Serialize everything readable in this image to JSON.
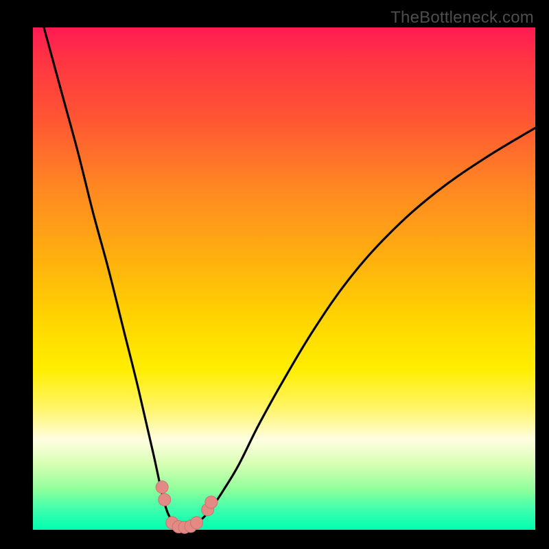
{
  "watermark": {
    "text": "TheBottleneck.com"
  },
  "colors": {
    "curve_stroke": "#000000",
    "marker_fill": "#e48a84",
    "marker_stroke": "#c9746e",
    "background": "#000000"
  },
  "chart_data": {
    "type": "line",
    "title": "",
    "xlabel": "",
    "ylabel": "",
    "xlim": [
      0,
      100
    ],
    "ylim": [
      0,
      100
    ],
    "curve": {
      "x": [
        0,
        3,
        6,
        9,
        12,
        15,
        18,
        21,
        24,
        26,
        27.5,
        29,
        30.5,
        32,
        34,
        36,
        38,
        41,
        45,
        50,
        56,
        63,
        71,
        80,
        90,
        100
      ],
      "y": [
        108,
        97,
        86,
        75,
        63,
        52,
        40,
        28,
        15,
        6,
        2,
        0.5,
        0.5,
        1,
        2.5,
        5,
        8,
        13,
        21,
        30,
        40,
        50,
        59,
        67,
        74,
        80
      ]
    },
    "markers": [
      {
        "x": 25.7,
        "y": 8.5
      },
      {
        "x": 26.2,
        "y": 6.0
      },
      {
        "x": 27.7,
        "y": 1.4
      },
      {
        "x": 29.0,
        "y": 0.6
      },
      {
        "x": 30.2,
        "y": 0.5
      },
      {
        "x": 31.4,
        "y": 0.7
      },
      {
        "x": 32.6,
        "y": 1.4
      },
      {
        "x": 34.8,
        "y": 4.0
      },
      {
        "x": 35.5,
        "y": 5.5
      }
    ]
  }
}
